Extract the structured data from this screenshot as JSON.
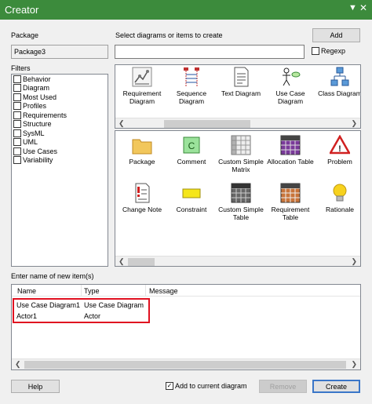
{
  "window": {
    "title": "Creator"
  },
  "package": {
    "label": "Package",
    "value": "Package3"
  },
  "select": {
    "label": "Select diagrams or items to create",
    "add_label": "Add",
    "search_value": "",
    "regexp_label": "Regexp"
  },
  "filters": {
    "label": "Filters",
    "items": [
      "Behavior",
      "Diagram",
      "Most Used",
      "Profiles",
      "Requirements",
      "Structure",
      "SysML",
      "UML",
      "Use Cases",
      "Variability"
    ]
  },
  "diagrams": [
    {
      "label": "Requirement Diagram",
      "icon": "requirement-diagram-icon"
    },
    {
      "label": "Sequence Diagram",
      "icon": "sequence-diagram-icon"
    },
    {
      "label": "Text Diagram",
      "icon": "text-diagram-icon"
    },
    {
      "label": "Use Case Diagram",
      "icon": "use-case-diagram-icon"
    },
    {
      "label": "Class Diagram",
      "icon": "class-diagram-icon"
    }
  ],
  "items": [
    {
      "label": "Package",
      "icon": "package-icon"
    },
    {
      "label": "Comment",
      "icon": "comment-icon"
    },
    {
      "label": "Custom Simple Matrix",
      "icon": "matrix-icon"
    },
    {
      "label": "Allocation Table",
      "icon": "allocation-table-icon"
    },
    {
      "label": "Problem",
      "icon": "problem-icon"
    },
    {
      "label": "Change Note",
      "icon": "change-note-icon"
    },
    {
      "label": "Constraint",
      "icon": "constraint-icon"
    },
    {
      "label": "Custom Simple Table",
      "icon": "custom-table-icon"
    },
    {
      "label": "Requirement Table",
      "icon": "requirement-table-icon"
    },
    {
      "label": "Rationale",
      "icon": "rationale-icon"
    }
  ],
  "new_items": {
    "label": "Enter name of new item(s)",
    "columns": [
      "Name",
      "Type",
      "Message"
    ],
    "rows": [
      {
        "name": "Use Case Diagram1",
        "type": "Use Case Diagram",
        "message": ""
      },
      {
        "name": "Actor1",
        "type": "Actor",
        "message": ""
      }
    ]
  },
  "footer": {
    "help_label": "Help",
    "add_to_diagram_label": "Add to current diagram",
    "add_to_diagram_checked": true,
    "remove_label": "Remove",
    "create_label": "Create"
  },
  "colors": {
    "titlebar": "#3c8b3c",
    "highlight": "#e01020",
    "create_border": "#3a76c8"
  }
}
